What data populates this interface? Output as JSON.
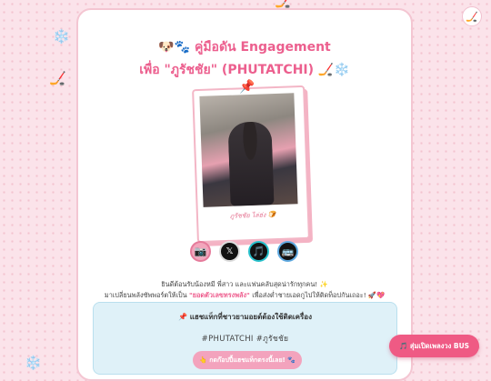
{
  "title_line1": "🐶🐾 คู่มือดัน Engagement",
  "title_line2": "เพื่อ \"ภูรัชชัย\" (PHUTATCHI) 🏒❄️",
  "photo_caption": "ภูรัชชัย ไล่ฮ่ง 🍞",
  "intro": {
    "line1": "ยินดีต้อนรับน้องหมี พี่สาว และแฟนคลับสุดน่ารักทุกคน! ✨",
    "line2_pre": "มาเปลี่ยนพลังซัพพอร์ตให้เป็น ",
    "line2_highlight": "\"ยอดตัวเลขทรงพลัง\"",
    "line2_post": " เพื่อส่งต่ำชายเอดกูไปให้ติดท็อปกันเถอะ! 🚀💖"
  },
  "tagbox": {
    "heading": "📌 แฮชแท็กที่ชาวยามอยต์ต้องใช้ติดเครื่อง",
    "tags": "#PHUTATCHI #ภูรัชชัย",
    "copy_button": "👆 กดก๊อปปี้แฮชแท็กตรงนี้เลย! 🐾"
  },
  "random_button": "🎵 สุ่มเปิดเพลงวง BUS",
  "socials": [
    {
      "name": "instagram",
      "glyph": "📷"
    },
    {
      "name": "x",
      "glyph": "𝕏"
    },
    {
      "name": "tiktok",
      "glyph": "🎵"
    },
    {
      "name": "bus",
      "glyph": "🚌"
    }
  ],
  "colors": {
    "accent": "#ec5f8e",
    "background": "#fbe3ea",
    "tagbox": "#dff1f8"
  }
}
